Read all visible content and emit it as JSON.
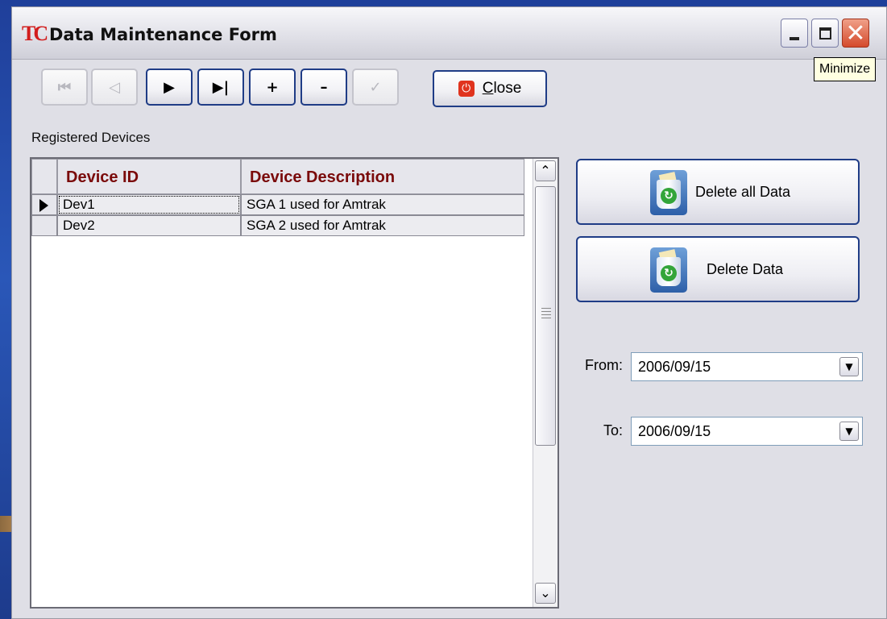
{
  "window": {
    "logo": "TC",
    "title": "Data Maintenance Form",
    "tooltip": "Minimize",
    "controls": {
      "minimize": "Minimize",
      "maximize": "Maximize",
      "close": "✕"
    }
  },
  "toolbar": {
    "first": "⏮",
    "prev": "◁",
    "next": "▶",
    "last": "▶|",
    "add": "+",
    "delete": "–",
    "post": "✓",
    "close_label_prefix": "C",
    "close_label_rest": "lose"
  },
  "devices": {
    "section_label": "Registered Devices",
    "columns": [
      "Device ID",
      "Device Description"
    ],
    "rows": [
      {
        "id": "Dev1",
        "description": "SGA 1 used for Amtrak",
        "current": true
      },
      {
        "id": "Dev2",
        "description": "SGA 2 used for Amtrak",
        "current": false
      }
    ]
  },
  "actions": {
    "delete_all": "Delete all Data",
    "delete": "Delete Data"
  },
  "dates": {
    "from_label": "From:",
    "from_value": "2006/09/15",
    "to_label": "To:",
    "to_value": "2006/09/15"
  }
}
